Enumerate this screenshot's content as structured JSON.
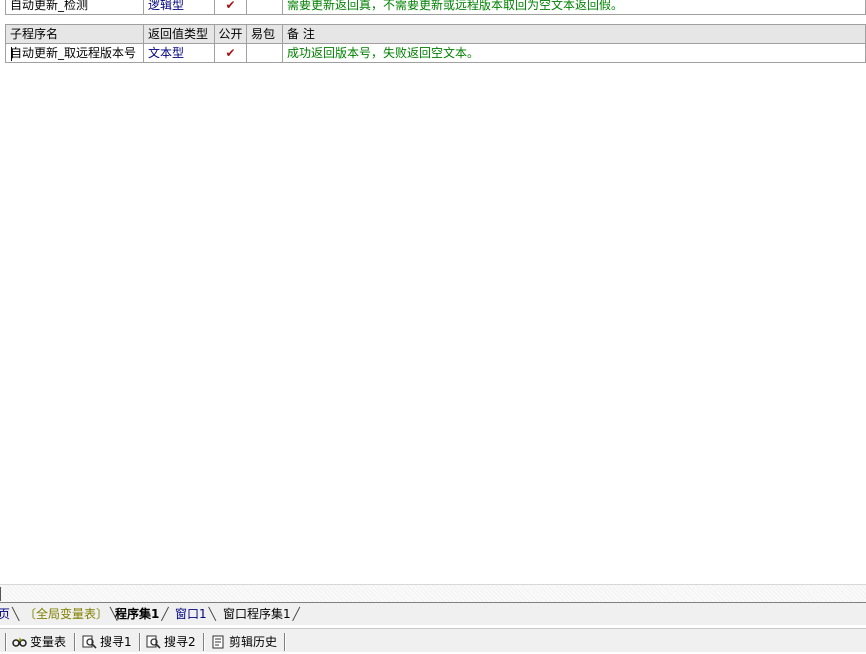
{
  "previous_subroutine": {
    "name": "自动更新_检测",
    "return_type": "逻辑型",
    "public": true,
    "note": "需要更新返回真，不需要更新或远程版本取回为空文本返回假。"
  },
  "table": {
    "headers": {
      "name": "子程序名",
      "return_type": "返回值类型",
      "public": "公开",
      "easy_pack": "易包",
      "note": "备 注"
    },
    "rows": [
      {
        "name": "自动更新_取远程版本号",
        "return_type": "文本型",
        "public": true,
        "easy_pack": "",
        "note": "成功返回版本号，失败返回空文本。"
      }
    ]
  },
  "check_mark": "✔",
  "tabs": [
    {
      "label": "页",
      "color": "#000080",
      "active": false
    },
    {
      "label": "〔全局变量表〕",
      "color": "#808000",
      "active": false
    },
    {
      "label": "程序集1",
      "color": "#000000",
      "active": true
    },
    {
      "label": "窗口1",
      "color": "#000080",
      "active": false
    },
    {
      "label": "窗口程序集1",
      "color": "#000000",
      "active": false
    }
  ],
  "bottom_tools": [
    {
      "label": "变量表",
      "icon": "variable-table-icon"
    },
    {
      "label": "搜寻1",
      "icon": "search-icon"
    },
    {
      "label": "搜寻2",
      "icon": "search-icon"
    },
    {
      "label": "剪辑历史",
      "icon": "clipboard-history-icon"
    }
  ]
}
